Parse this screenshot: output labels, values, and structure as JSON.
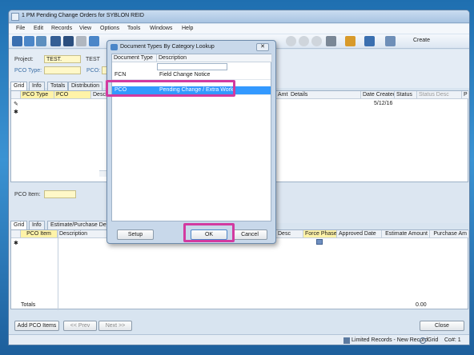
{
  "window": {
    "title": "1 PM Pending Change Orders for SYBLON REID"
  },
  "menu": [
    "File",
    "Edit",
    "Records",
    "View",
    "Options",
    "Tools",
    "Windows",
    "Help"
  ],
  "toolbar": {
    "create_label": "Create"
  },
  "header": {
    "project_label": "Project:",
    "project_value": "TEST.",
    "project_desc": "TEST",
    "pco_type_label": "PCO Type:",
    "pco_label": "PCO:"
  },
  "top_tabs": [
    "Grid",
    "Info",
    "Totals",
    "Distribution"
  ],
  "top_grid": {
    "columns_left": [
      "PCO Type",
      "PCO",
      "Desc"
    ],
    "columns_right": [
      "Amt",
      "Details",
      "Date Created",
      "Status",
      "Status Desc",
      "P"
    ],
    "row": {
      "date_created": "5/12/16"
    }
  },
  "pco_item_label": "PCO Item:",
  "bottom_tabs": [
    "Grid",
    "Info",
    "Estimate/Purchase Details"
  ],
  "bottom_grid": {
    "columns_left": [
      "PCO Item",
      "Description"
    ],
    "columns_right": [
      "Desc",
      "Force Phase",
      "Approved Date",
      "Estimate Amount",
      "Purchase Am"
    ],
    "totals_label": "Totals",
    "totals_value": "0.00"
  },
  "footer_buttons": {
    "add": "Add PCO Items",
    "prev": "<< Prev",
    "next": "Next >>",
    "close": "Close"
  },
  "status": {
    "records": "Limited Records - New Record",
    "grid": "Grid",
    "co": "Co#: 1"
  },
  "dialog": {
    "title": "Document Types By Category Lookup",
    "col_type": "Document Type",
    "col_desc": "Description",
    "rows": [
      {
        "type": "FCN",
        "desc": "Field Change Notice"
      },
      {
        "type": "PCO",
        "desc": "Pending Change / Extra Work"
      }
    ],
    "setup": "Setup",
    "ok": "OK",
    "cancel": "Cancel",
    "highlight_color": "#d23aa0",
    "selection_color": "#3399ff"
  }
}
